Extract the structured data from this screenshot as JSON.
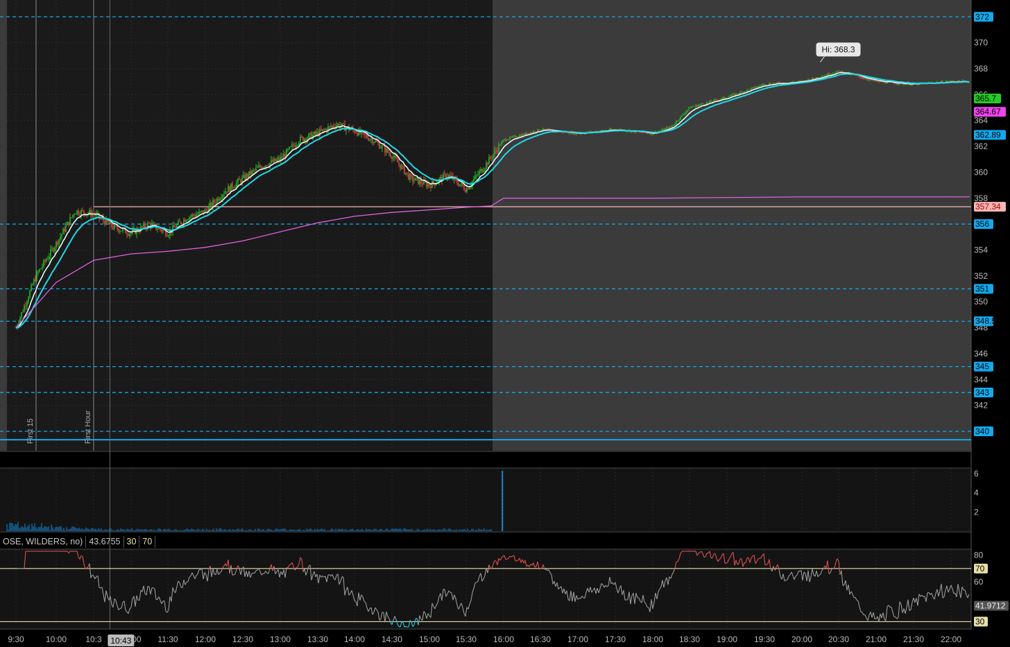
{
  "chart_data": {
    "type": "line",
    "price_panel": {
      "ylim": [
        338.5,
        373.3
      ],
      "y_ticks": [
        340,
        342,
        344,
        346,
        348,
        350,
        352,
        354,
        356,
        358,
        360,
        362,
        364,
        366,
        368,
        370,
        372
      ],
      "price_series": {
        "x": [
          "9:30",
          "9:45",
          "10:00",
          "10:15",
          "10:30",
          "10:45",
          "11:00",
          "11:15",
          "11:30",
          "11:45",
          "12:00",
          "12:15",
          "12:30",
          "12:45",
          "13:00",
          "13:15",
          "13:30",
          "13:45",
          "14:00",
          "14:15",
          "14:30",
          "14:45",
          "15:00",
          "15:15",
          "15:30",
          "15:45",
          "16:00",
          "16:30",
          "17:00",
          "17:30",
          "18:00",
          "18:15",
          "18:30",
          "19:00",
          "19:30",
          "20:00",
          "20:30",
          "21:00",
          "21:30",
          "22:00",
          "22:15"
        ],
        "y": [
          348,
          352,
          354.5,
          357,
          356.8,
          355.8,
          355.3,
          356,
          355.3,
          356.5,
          357,
          358.5,
          359.5,
          360.5,
          361,
          362.5,
          363,
          363.7,
          363.2,
          362.5,
          361.3,
          359.5,
          359,
          359.8,
          358.7,
          360.5,
          362.5,
          363.3,
          363,
          363.3,
          363,
          363.5,
          365,
          365.8,
          366.8,
          367,
          367.8,
          367,
          366.8,
          367,
          367
        ]
      },
      "vwap_series": {
        "x": [
          "9:30",
          "10:00",
          "10:30",
          "11:00",
          "11:30",
          "12:00",
          "12:30",
          "13:00",
          "13:30",
          "14:00",
          "14:30",
          "15:00",
          "15:30",
          "15:50",
          "16:00",
          "18:00",
          "20:00",
          "22:15"
        ],
        "y": [
          348,
          351.5,
          353.2,
          353.7,
          353.9,
          354.2,
          354.7,
          355.4,
          356.1,
          356.6,
          356.9,
          357.1,
          357.3,
          357.4,
          358,
          358,
          358.1,
          358.1
        ]
      },
      "levels": [
        {
          "label": "372",
          "value": 372
        },
        {
          "label": "356",
          "value": 356
        },
        {
          "label": "351",
          "value": 351
        },
        {
          "label": "348.5",
          "value": 348.5
        },
        {
          "label": "345",
          "value": 345
        },
        {
          "label": "343",
          "value": 343
        },
        {
          "label": "340",
          "value": 340
        }
      ],
      "solid_level": 339.35,
      "reference_line": 357.34,
      "badges": [
        {
          "label": "365.7",
          "value": 365.7,
          "color": "#22cc22",
          "text_color": "#000000"
        },
        {
          "label": "364.67",
          "value": 364.67,
          "color": "#ee44ee",
          "text_color": "#000000"
        },
        {
          "label": "362.89",
          "value": 362.89,
          "color": "#11aaee",
          "text_color": "#000000"
        },
        {
          "label": "357.34",
          "value": 357.34,
          "color": "#f7b6b6",
          "text_color": "#aa0000"
        }
      ],
      "high_annotation": {
        "label": "Hi: 368.3",
        "x": "20:15",
        "value": 368.3
      },
      "session_markers": [
        {
          "label": "First 15",
          "x": "9:45"
        },
        {
          "label": "First Hour",
          "x": "10:30"
        }
      ],
      "cursor_x": "10:43"
    },
    "volume_panel": {
      "ylim": [
        0,
        6.5
      ],
      "y_ticks": [
        2,
        4,
        6
      ],
      "spike": {
        "x": "15:59",
        "value": 6.3
      }
    },
    "rsi_panel": {
      "header": {
        "study": "OSE, WILDERS, no)",
        "value": "43.6755",
        "oversold": "30",
        "overbought": "70"
      },
      "ylim": [
        25,
        84
      ],
      "y_ticks": [
        60,
        80
      ],
      "overbought": 70,
      "oversold": 30,
      "overbought_label": "70",
      "oversold_label": "30",
      "current_label": "41.9712",
      "current_value": 41.97
    },
    "x_axis": {
      "ticks": [
        "9:30",
        "10:00",
        "10:3",
        "11:00",
        "11:30",
        "12:00",
        "12:30",
        "13:00",
        "13:30",
        "14:00",
        "14:30",
        "15:00",
        "15:30",
        "16:00",
        "16:30",
        "17:00",
        "17:30",
        "18:00",
        "18:30",
        "19:00",
        "19:30",
        "20:00",
        "20:30",
        "21:00",
        "21:30",
        "22:00"
      ],
      "cursor_label": "10:43"
    },
    "colors": {
      "background": "#000000",
      "regular_session": "#1a1a1a",
      "extended_session": "#3b3b3b",
      "candle_up": "#22bb22",
      "candle_down": "#dd4444",
      "ema_fast": "#e8f8f8",
      "ema_slow": "#22d8e8",
      "vwap": "#e060e0",
      "level_line": "#11aaee",
      "reference_line": "#f4b8b8",
      "rsi_line": "#9a9a9a",
      "rsi_overbought": "#e05050",
      "rsi_oversold": "#22ccdd",
      "rsi_bounds": "#e8e0a8",
      "volume": "#1188dd"
    }
  }
}
